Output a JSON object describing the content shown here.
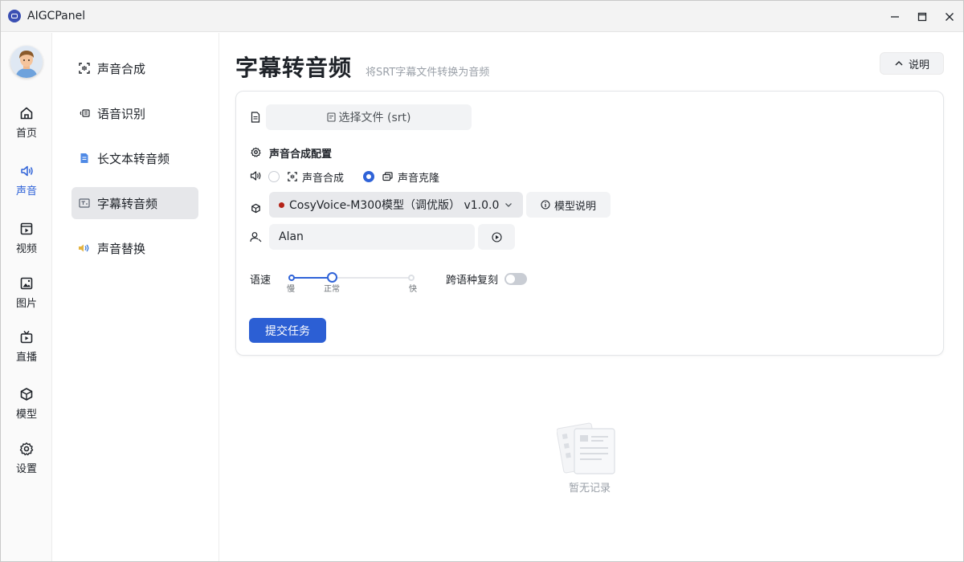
{
  "app": {
    "title": "AIGCPanel"
  },
  "window_controls": {
    "minimize": "minimize-icon",
    "maximize": "maximize-icon",
    "close": "close-icon"
  },
  "iconnav": {
    "items": [
      {
        "label": "首页",
        "icon": "home-icon",
        "active": false
      },
      {
        "label": "声音",
        "icon": "speaker-icon",
        "active": true
      },
      {
        "label": "视频",
        "icon": "video-icon",
        "active": false
      },
      {
        "label": "图片",
        "icon": "image-icon",
        "active": false
      },
      {
        "label": "直播",
        "icon": "live-icon",
        "active": false
      },
      {
        "label": "模型",
        "icon": "cube-icon",
        "active": false
      },
      {
        "label": "设置",
        "icon": "gear-icon",
        "active": false
      }
    ]
  },
  "subnav": {
    "items": [
      {
        "label": "声音合成",
        "icon": "scan-icon",
        "active": false
      },
      {
        "label": "语音识别",
        "icon": "voice-recognition-icon",
        "active": false
      },
      {
        "label": "长文本转音频",
        "icon": "document-icon",
        "active": false
      },
      {
        "label": "字幕转音频",
        "icon": "subtitle-icon",
        "active": true
      },
      {
        "label": "声音替换",
        "icon": "swap-sound-icon",
        "active": false
      }
    ]
  },
  "main": {
    "title": "字幕转音频",
    "subtitle": "将SRT字幕文件转换为音频",
    "help_label": "说明"
  },
  "form": {
    "file_button": "选择文件 (srt)",
    "config_title": "声音合成配置",
    "radio_options": [
      {
        "label": "声音合成",
        "checked": false
      },
      {
        "label": "声音克隆",
        "checked": true
      }
    ],
    "model_value": "CosyVoice-M300模型（调优版） v1.0.0",
    "model_status_color": "#b42318",
    "model_help": "模型说明",
    "voice_value": "Alan",
    "speed_label": "语速",
    "speed_marks": [
      "慢",
      "正常",
      "快"
    ],
    "speed_value": "正常",
    "cross_lingual_label": "跨语种复刻",
    "cross_lingual_on": false,
    "submit_label": "提交任务"
  },
  "records": {
    "empty_text": "暂无记录"
  },
  "colors": {
    "accent": "#2f63d8",
    "submit": "#2c5fd4"
  }
}
